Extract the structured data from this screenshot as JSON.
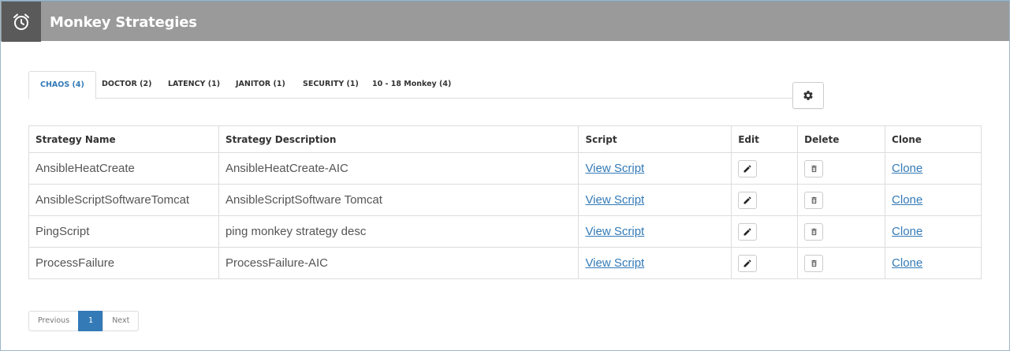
{
  "header": {
    "title": "Monkey Strategies",
    "icon": "alarm-clock-icon"
  },
  "tabs": [
    {
      "label": "CHAOS (4)",
      "active": true
    },
    {
      "label": "DOCTOR (2)",
      "active": false
    },
    {
      "label": "LATENCY (1)",
      "active": false
    },
    {
      "label": "JANITOR (1)",
      "active": false
    },
    {
      "label": "SECURITY (1)",
      "active": false
    },
    {
      "label": "10 - 18 Monkey (4)",
      "active": false
    }
  ],
  "settings": {
    "icon": "gear-icon"
  },
  "table": {
    "headers": {
      "name": "Strategy Name",
      "description": "Strategy Description",
      "script": "Script",
      "edit": "Edit",
      "delete": "Delete",
      "clone": "Clone"
    },
    "rows": [
      {
        "name": "AnsibleHeatCreate",
        "description": "AnsibleHeatCreate-AIC",
        "script": "View Script",
        "clone": "Clone"
      },
      {
        "name": "AnsibleScriptSoftwareTomcat",
        "description": "AnsibleScriptSoftware Tomcat",
        "script": "View Script",
        "clone": "Clone"
      },
      {
        "name": "PingScript",
        "description": "ping monkey strategy desc",
        "script": "View Script",
        "clone": "Clone"
      },
      {
        "name": "ProcessFailure",
        "description": "ProcessFailure-AIC",
        "script": "View Script",
        "clone": "Clone"
      }
    ]
  },
  "pagination": {
    "previous": "Previous",
    "current": "1",
    "next": "Next"
  },
  "colors": {
    "header_bg": "#9a9a9a",
    "header_icon_bg": "#5a5a5a",
    "accent": "#337ab7"
  }
}
